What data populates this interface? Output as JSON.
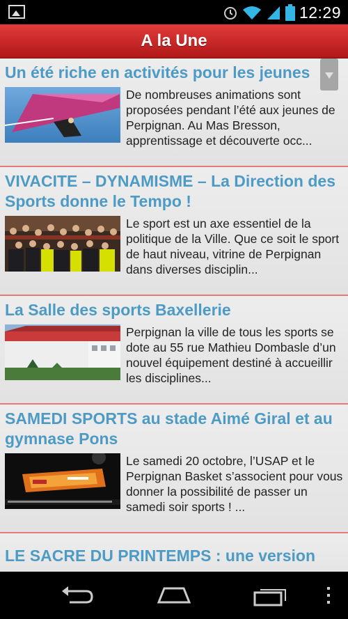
{
  "status_bar": {
    "time": "12:29",
    "icons": [
      "gallery-icon",
      "alarm-icon",
      "wifi-icon",
      "signal-icon",
      "battery-icon"
    ]
  },
  "app_bar": {
    "title": "A la Une",
    "color": "#c62828"
  },
  "articles": [
    {
      "headline": "Un été riche en activités pour les jeunes",
      "excerpt": "De nombreuses animations sont proposées pendant l’été aux jeunes  de Perpignan. Au Mas Bresson, apprentissage et découverte occ..."
    },
    {
      "headline": "VIVACITE – DYNAMISME – La Direction des Sports donne le Tempo !",
      "excerpt": "Le sport est un axe essentiel de la politique de la Ville. Que ce soit le sport de haut niveau, vitrine de Perpignan dans diverses disciplin..."
    },
    {
      "headline": "La Salle des sports Baxellerie",
      "excerpt": "Perpignan la ville de tous les sports  se dote au 55 rue Mathieu Dombasle d’un nouvel équipement destiné à accueillir les disciplines..."
    },
    {
      "headline": "SAMEDI SPORTS au stade Aimé Giral et au gymnase Pons",
      "excerpt": "Le samedi 20 octobre, l’USAP et le Perpignan Basket s’associent pour vous donner la possibilité de passer un samedi soir sports ! ..."
    },
    {
      "headline": "LE SACRE DU PRINTEMPS : une version",
      "excerpt": ""
    }
  ],
  "nav_bar": {
    "buttons": [
      "back-icon",
      "home-icon",
      "recent-apps-icon",
      "menu-icon"
    ]
  },
  "colors": {
    "headline": "#4d9bc5",
    "divider": "#e37b7b"
  }
}
